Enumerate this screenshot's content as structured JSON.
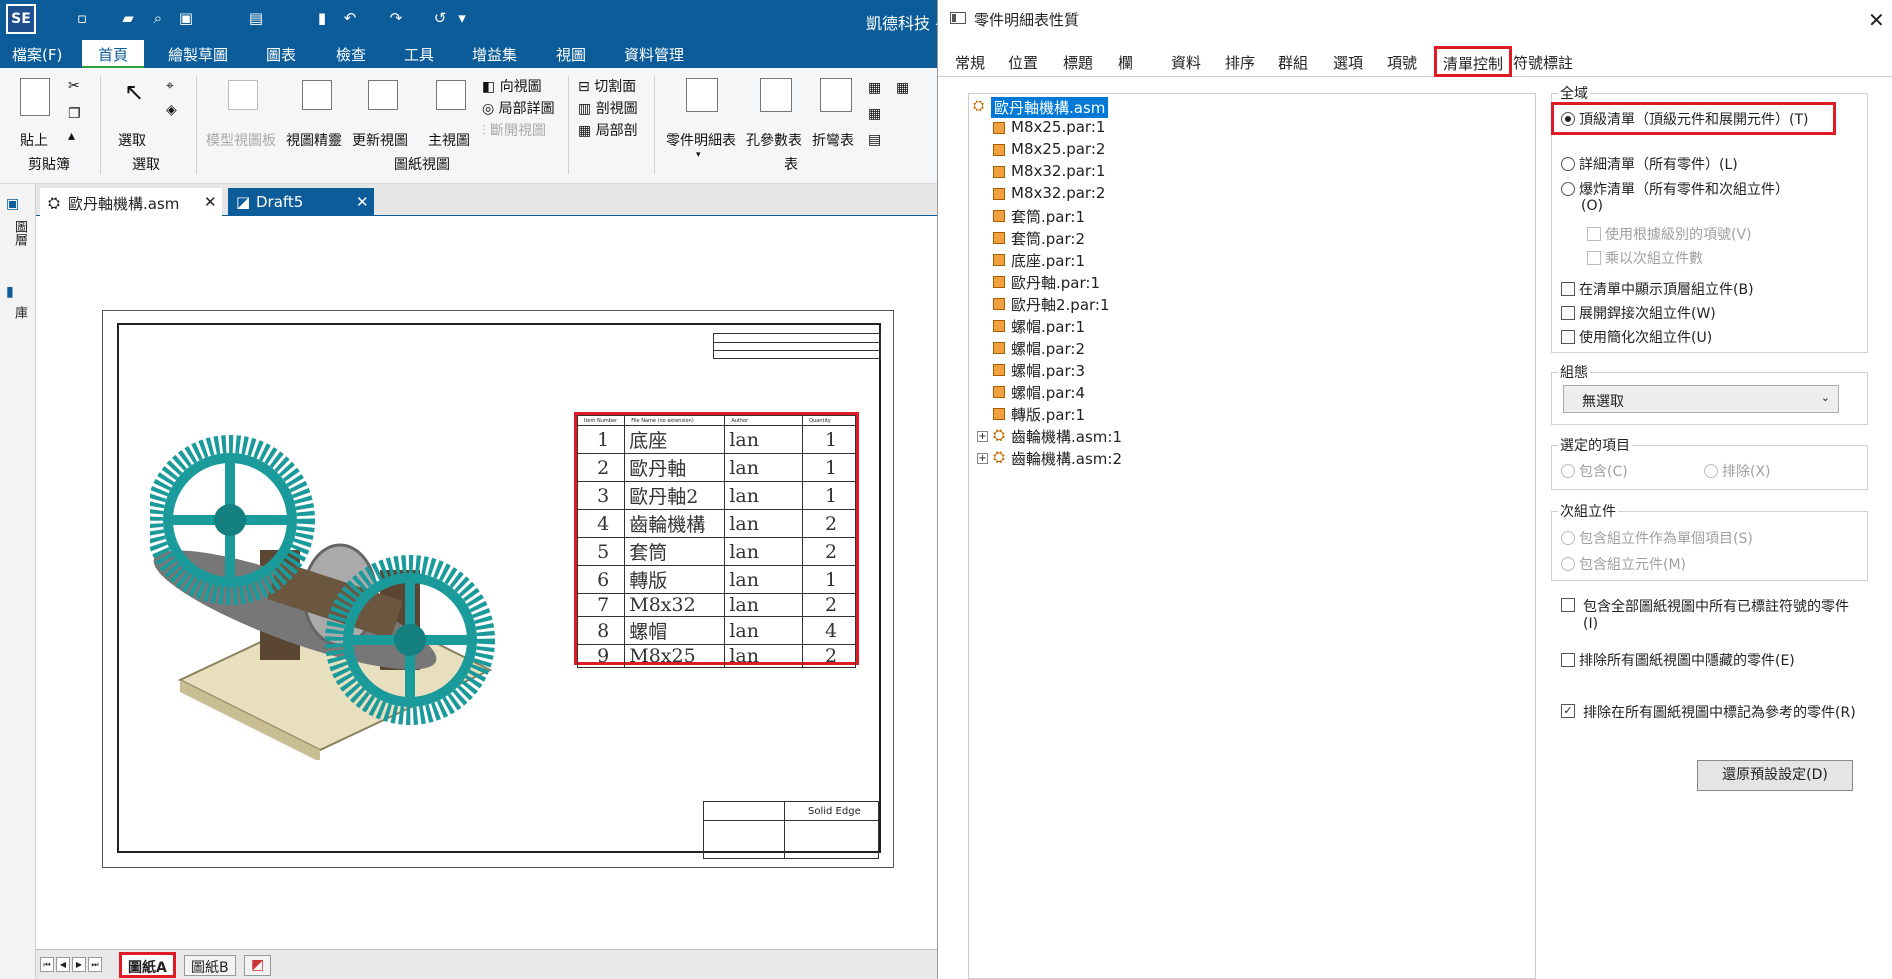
{
  "app": {
    "logo": "SE",
    "title": "凱德科技 -"
  },
  "menu": [
    "檔案(F)",
    "首頁",
    "繪製草圖",
    "圖表",
    "檢查",
    "工具",
    "增益集",
    "視圖",
    "資料管理"
  ],
  "ribbon": {
    "paste": "貼上",
    "select": "選取",
    "clipboard_group": "剪貼簿",
    "select_group": "選取",
    "model_view": "模型視圖板",
    "view_wizard": "視圖精靈",
    "update_views": "更新視圖",
    "main_view": "主視圖",
    "aux_view": "向視圖",
    "detail_view": "局部詳圖",
    "broken_view": "斷開視圖",
    "section_plane": "切割面",
    "section_view": "剖視圖",
    "broken_out": "局部剖",
    "drawing_views_group": "圖紙視圖",
    "parts_list": "零件明細表",
    "hole_table": "孔參數表",
    "bend_table": "折彎表",
    "tables_group": "表"
  },
  "leftstrip": [
    "圖層",
    "庫"
  ],
  "doctabs": [
    {
      "label": "歐丹軸機構.asm"
    },
    {
      "label": "Draft5"
    }
  ],
  "bom": {
    "headers": [
      "Item Number",
      "File Name (no extension)",
      "Author",
      "Quantity"
    ],
    "rows": [
      {
        "n": "1",
        "name": "底座",
        "author": "lan",
        "qty": "1"
      },
      {
        "n": "2",
        "name": "歐丹軸",
        "author": "lan",
        "qty": "1"
      },
      {
        "n": "3",
        "name": "歐丹軸2",
        "author": "lan",
        "qty": "1"
      },
      {
        "n": "4",
        "name": "齒輪機構",
        "author": "lan",
        "qty": "2"
      },
      {
        "n": "5",
        "name": "套筒",
        "author": "lan",
        "qty": "2"
      },
      {
        "n": "6",
        "name": "轉版",
        "author": "lan",
        "qty": "1"
      },
      {
        "n": "7",
        "name": "M8x32",
        "author": "lan",
        "qty": "2"
      },
      {
        "n": "8",
        "name": "螺帽",
        "author": "lan",
        "qty": "4"
      },
      {
        "n": "9",
        "name": "M8x25",
        "author": "lan",
        "qty": "2"
      }
    ]
  },
  "title_block": {
    "brand": "Solid Edge"
  },
  "sheettabs": [
    "圖紙A",
    "圖紙B"
  ],
  "dialog": {
    "title": "零件明細表性質",
    "close": "✕",
    "tabs": [
      "常規",
      "位置",
      "標題",
      "欄",
      "資料",
      "排序",
      "群組",
      "選項",
      "項號",
      "清單控制",
      "符號標註"
    ],
    "tree": {
      "root": "歐丹軸機構.asm",
      "parts": [
        "M8x25.par:1",
        "M8x25.par:2",
        "M8x32.par:1",
        "M8x32.par:2",
        "套筒.par:1",
        "套筒.par:2",
        "底座.par:1",
        "歐丹軸.par:1",
        "歐丹軸2.par:1",
        "螺帽.par:1",
        "螺帽.par:2",
        "螺帽.par:3",
        "螺帽.par:4",
        "轉版.par:1"
      ],
      "subasm": [
        "齒輪機構.asm:1",
        "齒輪機構.asm:2"
      ]
    },
    "global_label": "全域",
    "top_level": "頂級清單（頂級元件和展開元件）(T)",
    "detailed": "詳細清單（所有零件）(L)",
    "exploded": "爆炸清單（所有零件和次組立件）",
    "exploded_key": "(O)",
    "use_level_items": "使用根據級別的項號(V)",
    "multiply_qty": "乘以次組立件數",
    "show_top_asm": "在清單中顯示頂層組立件(B)",
    "expand_weld": "展開銲接次組立件(W)",
    "use_simplified": "使用簡化次組立件(U)",
    "config_label": "組態",
    "config_value": "無選取",
    "selected_label": "選定的項目",
    "include": "包含(C)",
    "exclude": "排除(X)",
    "subasm_label": "次組立件",
    "include_single": "包含組立件作為單個項目(S)",
    "include_members": "包含組立元件(M)",
    "include_all_balloons": "包含全部圖紙視圖中所有已標註符號的零件(I)",
    "exclude_hidden": "排除所有圖紙視圖中隱藏的零件(E)",
    "exclude_reference": "排除在所有圖紙視圖中標記為參考的零件(R)",
    "reset": "還原預設設定(D)"
  }
}
